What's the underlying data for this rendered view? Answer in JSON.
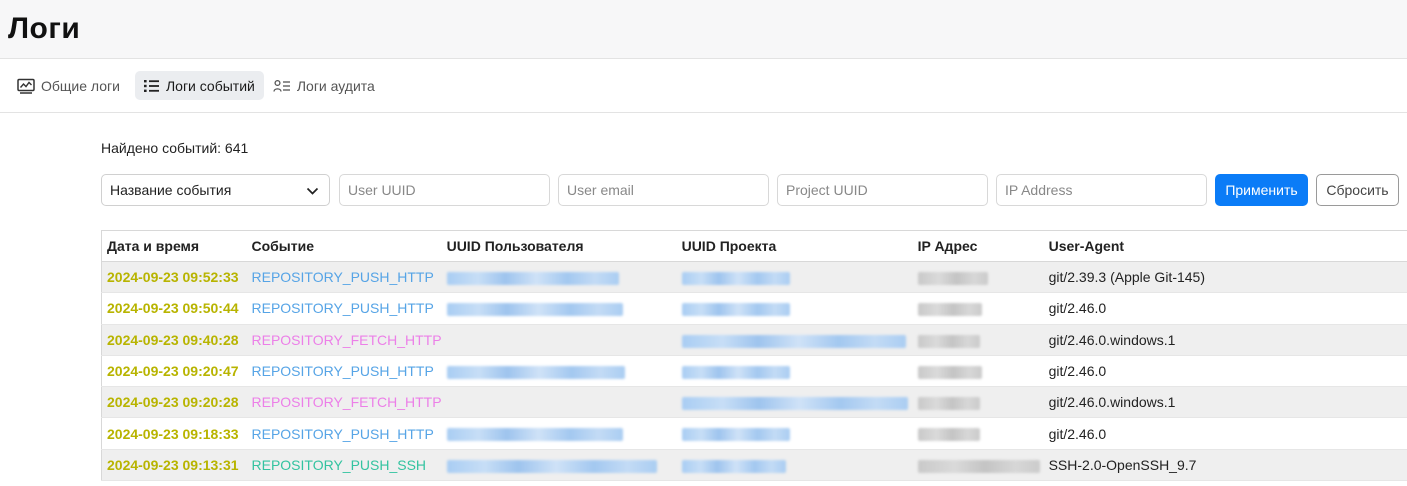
{
  "header": {
    "title": "Логи"
  },
  "tabs": [
    {
      "label": "Общие логи",
      "icon": "chart-monitor-icon",
      "active": false
    },
    {
      "label": "Логи событий",
      "icon": "list-icon",
      "active": true
    },
    {
      "label": "Логи аудита",
      "icon": "user-list-icon",
      "active": false
    }
  ],
  "found_text": "Найдено событий: 641",
  "filters": {
    "event_select": "Название события",
    "user_uuid_placeholder": "User UUID",
    "user_email_placeholder": "User email",
    "project_uuid_placeholder": "Project UUID",
    "ip_placeholder": "IP Address",
    "apply_label": "Применить",
    "reset_label": "Сбросить"
  },
  "table": {
    "columns": [
      "Дата и время",
      "Событие",
      "UUID Пользователя",
      "UUID Проекта",
      "IP Адрес",
      "User-Agent"
    ],
    "rows": [
      {
        "datetime": "2024-09-23 09:52:33",
        "event": "REPOSITORY_PUSH_HTTP",
        "user_agent": "git/2.39.3 (Apple Git-145)"
      },
      {
        "datetime": "2024-09-23 09:50:44",
        "event": "REPOSITORY_PUSH_HTTP",
        "user_agent": "git/2.46.0"
      },
      {
        "datetime": "2024-09-23 09:40:28",
        "event": "REPOSITORY_FETCH_HTTP",
        "user_agent": "git/2.46.0.windows.1"
      },
      {
        "datetime": "2024-09-23 09:20:47",
        "event": "REPOSITORY_PUSH_HTTP",
        "user_agent": "git/2.46.0"
      },
      {
        "datetime": "2024-09-23 09:20:28",
        "event": "REPOSITORY_FETCH_HTTP",
        "user_agent": "git/2.46.0.windows.1"
      },
      {
        "datetime": "2024-09-23 09:18:33",
        "event": "REPOSITORY_PUSH_HTTP",
        "user_agent": "git/2.46.0"
      },
      {
        "datetime": "2024-09-23 09:13:31",
        "event": "REPOSITORY_PUSH_SSH",
        "user_agent": "SSH-2.0-OpenSSH_9.7"
      }
    ]
  },
  "colors": {
    "accent": "#0b7cf7",
    "datetime": "#b8b400",
    "push_http": "#56a4e6",
    "fetch_http": "#ec7fe8",
    "push_ssh": "#33c3a0"
  }
}
